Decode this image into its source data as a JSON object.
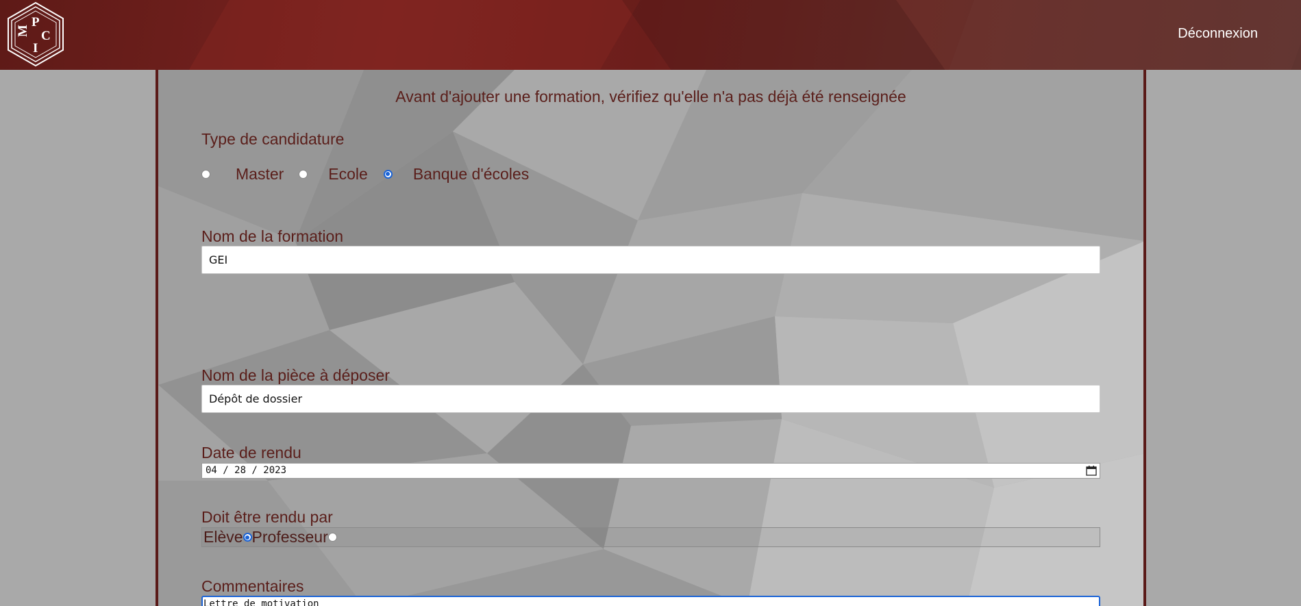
{
  "header": {
    "logo_text": "IPCM",
    "logout_label": "Déconnexion"
  },
  "form": {
    "notice": "Avant d'ajouter une formation, vérifiez qu'elle n'a pas déjà été renseignée",
    "type_label": "Type de candidature",
    "type_options": [
      "Master",
      "Ecole",
      "Banque d'écoles"
    ],
    "type_selected": "Banque d'écoles",
    "formation_label": "Nom de la formation",
    "formation_value": "GEI",
    "piece_label": "Nom de la pièce à déposer",
    "piece_value": "Dépôt de dossier",
    "date_label": "Date de rendu",
    "date_value": "04 / 28 / 2023",
    "rendu_label": "Doit être rendu par",
    "rendu_options": [
      "Elève",
      "Professeur"
    ],
    "rendu_selected": "Elève",
    "comments_label": "Commentaires",
    "comments_value": "Lettre de motivation"
  },
  "colors": {
    "header_bg": "#6c1e1b",
    "label_text": "#5a1e1a",
    "panel_border": "#5a1a18",
    "radio_accent": "#1a63d6"
  }
}
